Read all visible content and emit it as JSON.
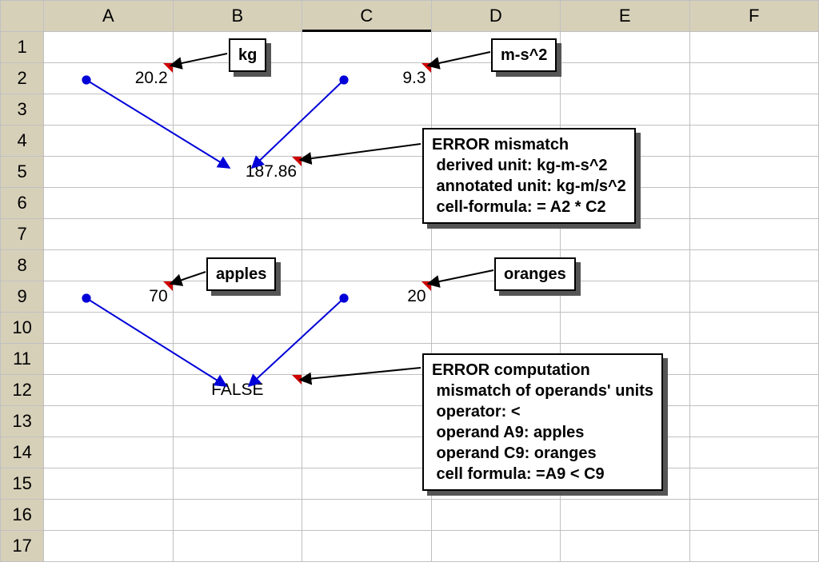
{
  "columns": [
    "A",
    "B",
    "C",
    "D",
    "E",
    "F"
  ],
  "active_column": "C",
  "row_count": 17,
  "cells": {
    "A2": {
      "display": "20.2",
      "fill": "pink",
      "comment": true
    },
    "C2": {
      "display": "9.3",
      "fill": "pink",
      "comment": true
    },
    "B5": {
      "display": "187.86",
      "fill": "orange",
      "comment": true
    },
    "A9": {
      "display": "70",
      "fill": "pink",
      "comment": true
    },
    "C9": {
      "display": "20",
      "fill": "pink",
      "comment": true
    },
    "B12": {
      "display": "FALSE",
      "fill": "yellow",
      "comment": true
    }
  },
  "tooltips": {
    "A2": "kg",
    "C2": "m-s^2",
    "B5": "ERROR mismatch\n derived unit: kg-m-s^2\n annotated unit: kg-m/s^2\n cell-formula: = A2 * C2",
    "A9": "apples",
    "C9": "oranges",
    "B12": "ERROR computation\n mismatch of operands' units\n operator: <\n operand A9: apples\n operand C9: oranges\n cell formula: =A9 < C9"
  },
  "trace_arrows": [
    {
      "from": "A2",
      "to": "B5"
    },
    {
      "from": "C2",
      "to": "B5"
    },
    {
      "from": "A9",
      "to": "B12"
    },
    {
      "from": "C9",
      "to": "B12"
    }
  ],
  "colors": {
    "pink": "#f49292",
    "orange": "#f29e18",
    "yellow": "#fffd00",
    "header": "#d7d0b9",
    "arrow": "#0000d8"
  }
}
